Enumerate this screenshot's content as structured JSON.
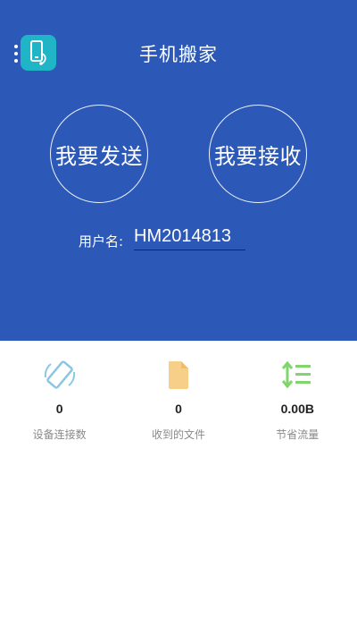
{
  "header": {
    "title": "手机搬家",
    "menu_icon": "more-vertical-icon",
    "app_icon": "phone-transfer-icon",
    "brand_color": "#2c58b8",
    "icon_bg_color": "#1fb5c6"
  },
  "actions": {
    "send_label": "我要发送",
    "receive_label": "我要接收"
  },
  "user": {
    "label": "用户名:",
    "value": "HM2014813"
  },
  "stats": [
    {
      "icon": "rotate-device-icon",
      "value": "0",
      "label": "设备连接数",
      "color": "#8cc7e2"
    },
    {
      "icon": "file-icon",
      "value": "0",
      "label": "收到的文件",
      "color": "#f7cf88"
    },
    {
      "icon": "traffic-icon",
      "value": "0.00B",
      "label": "节省流量",
      "color": "#7fd66a"
    }
  ]
}
